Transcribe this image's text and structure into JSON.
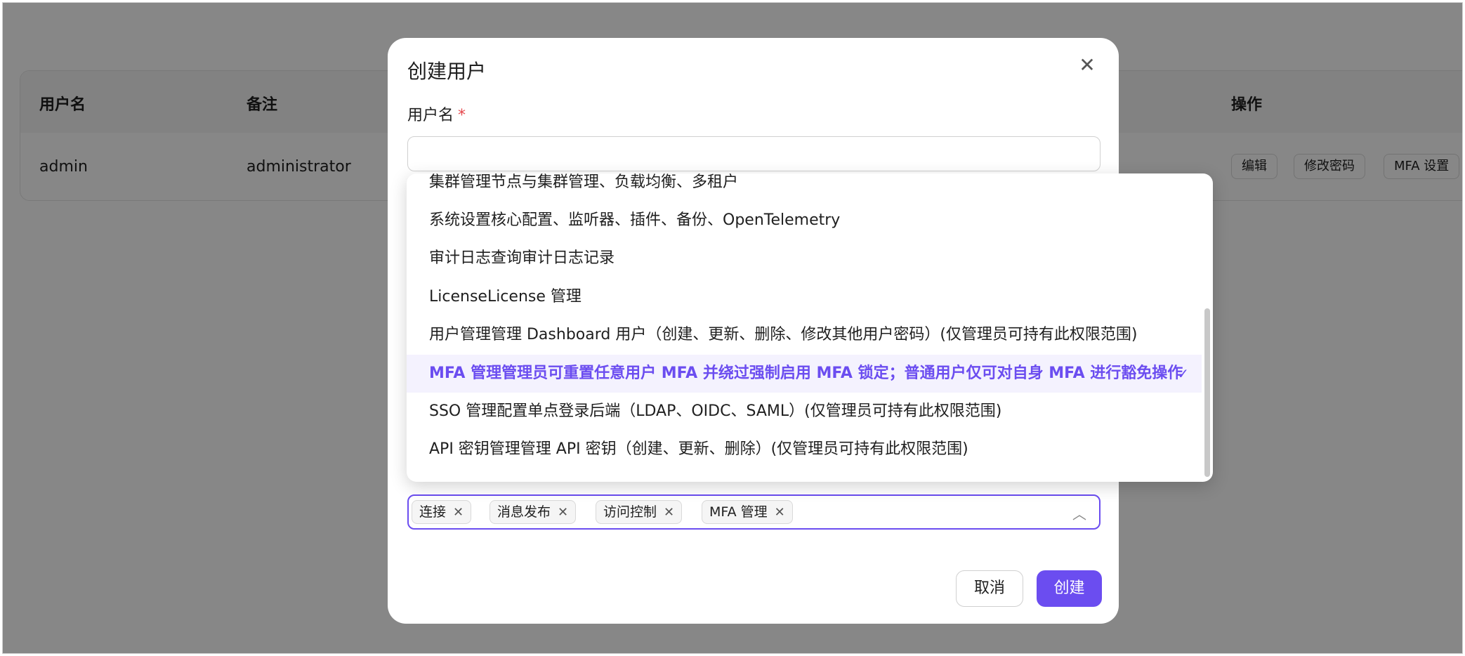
{
  "table": {
    "headers": {
      "username": "用户名",
      "note": "备注",
      "actions": "操作"
    },
    "row": {
      "username": "admin",
      "note": "administrator"
    },
    "row_buttons": {
      "edit": "编辑",
      "change_password": "修改密码",
      "mfa": "MFA 设置"
    }
  },
  "modal": {
    "title": "创建用户",
    "username_label": "用户名",
    "required_mark": "*",
    "username_value": "",
    "cancel": "取消",
    "create": "创建"
  },
  "dropdown": {
    "options": [
      "集群管理节点与集群管理、负载均衡、多租户",
      "系统设置核心配置、监听器、插件、备份、OpenTelemetry",
      "审计日志查询审计日志记录",
      "LicenseLicense 管理",
      "用户管理管理 Dashboard 用户（创建、更新、删除、修改其他用户密码）(仅管理员可持有此权限范围)",
      "MFA 管理管理员可重置任意用户 MFA 并绕过强制启用 MFA 锁定；普通用户仅可对自身 MFA 进行豁免操作",
      "SSO 管理配置单点登录后端（LDAP、OIDC、SAML）(仅管理员可持有此权限范围)",
      "API 密钥管理管理 API 密钥（创建、更新、删除）(仅管理员可持有此权限范围)"
    ],
    "selected_index": 5,
    "check_icon": "✓"
  },
  "selected_tags": [
    "连接",
    "消息发布",
    "访问控制",
    "MFA 管理"
  ],
  "icons": {
    "close": "✕",
    "tag_remove": "✕",
    "chevron_up": "︿"
  },
  "colors": {
    "accent": "#6b4df0",
    "required": "#e5484d"
  }
}
